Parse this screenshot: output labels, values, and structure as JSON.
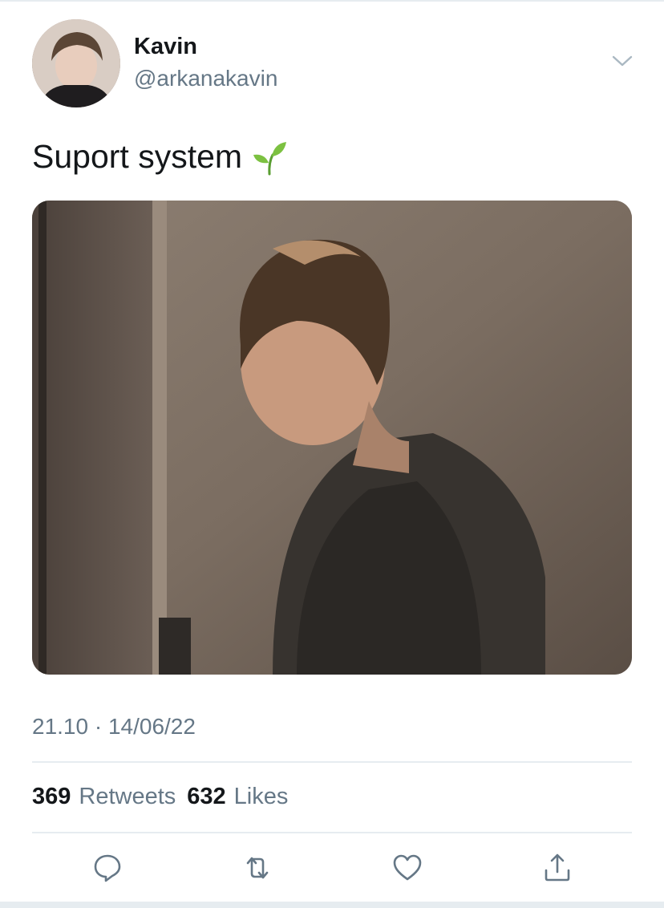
{
  "author": {
    "name": "Kavin",
    "handle": "@arkanakavin",
    "avatar_icon": "profile-photo"
  },
  "tweet": {
    "text": "Suport system",
    "emoji_icon": "seedling-emoji",
    "image_icon": "photo-man-looking-down"
  },
  "meta": {
    "timestamp": "21.10 · 14/06/22"
  },
  "stats": {
    "retweets_count": "369",
    "retweets_label": "Retweets",
    "likes_count": "632",
    "likes_label": "Likes"
  },
  "actions": {
    "reply_icon": "reply-icon",
    "retweet_icon": "retweet-icon",
    "like_icon": "heart-icon",
    "share_icon": "share-icon"
  },
  "colors": {
    "text": "#14171a",
    "secondary": "#657786",
    "divider": "#e6ecf0",
    "background": "#ffffff"
  }
}
